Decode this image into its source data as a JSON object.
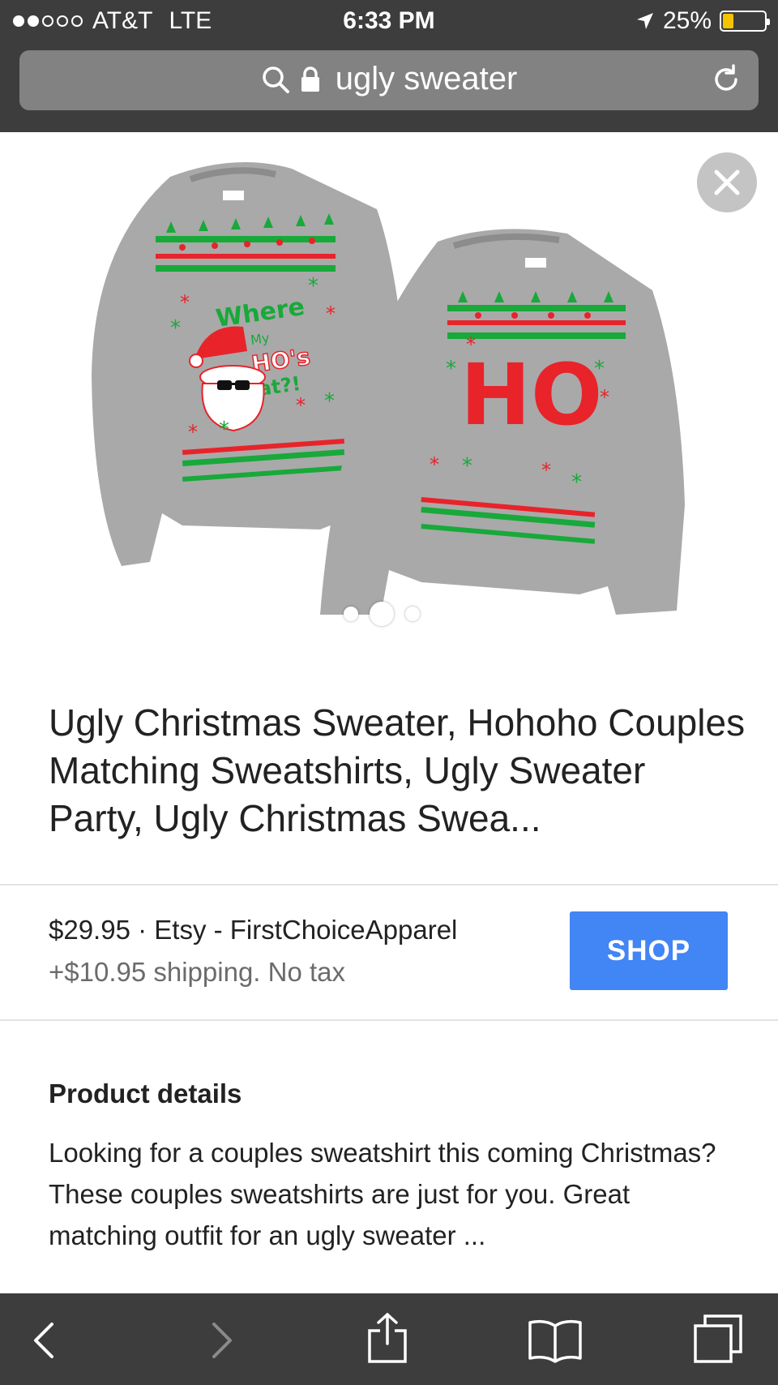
{
  "status_bar": {
    "carrier": "AT&T",
    "network": "LTE",
    "time": "6:33 PM",
    "battery": "25%",
    "battery_level": 0.25
  },
  "url_bar": {
    "query": "ugly sweater",
    "icons": [
      "search-icon",
      "lock-icon",
      "reload-icon"
    ]
  },
  "product": {
    "image_text": {
      "left_sweater": [
        "Where",
        "My",
        "HO's",
        "at?!"
      ],
      "right_sweater": "HO"
    },
    "carousel": {
      "count": 3,
      "active": 2
    },
    "title": "Ugly Christmas Sweater, Hohoho Couples Matching Sweatshirts, Ugly Sweater Party, Ugly Christmas Swea...",
    "price_line": "$29.95 · Etsy - FirstChoiceApparel",
    "shipping_line": "+$10.95 shipping. No tax",
    "shop_label": "SHOP"
  },
  "details": {
    "heading": "Product details",
    "body": "Looking for a couples sweatshirt this coming Christmas? These couples sweatshirts are just for you. Great matching outfit for an ugly sweater ..."
  },
  "toolbar": {
    "icons": [
      "back-icon",
      "forward-icon",
      "share-icon",
      "bookmarks-icon",
      "tabs-icon"
    ]
  },
  "colors": {
    "chrome": "#3d3d3d",
    "url_field": "#828282",
    "shop_blue": "#4285f4",
    "sweater_gray": "#a9a9a9",
    "sweater_red": "#e8232a",
    "sweater_green": "#18a93a",
    "battery_yellow": "#f5c400"
  }
}
